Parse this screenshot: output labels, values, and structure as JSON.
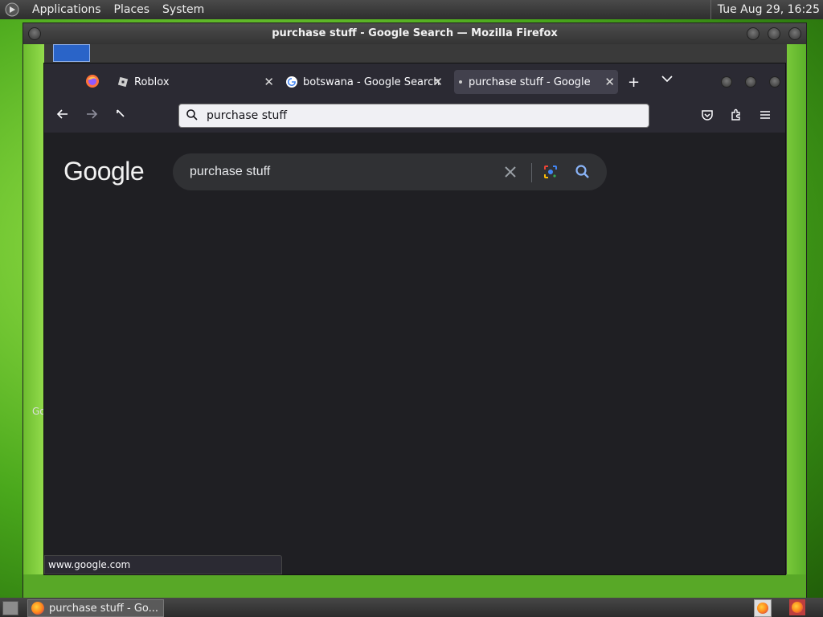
{
  "top_panel": {
    "menus": [
      "Applications",
      "Places",
      "System"
    ],
    "clock": "Tue Aug 29, 16:25"
  },
  "outer_window": {
    "title": "purchase stuff - Google Search — Mozilla Firefox",
    "left_strip_text": "Go"
  },
  "browser": {
    "tabs": [
      {
        "title": "Roblox",
        "icon": "roblox-icon",
        "active": false
      },
      {
        "title": "botswana - Google Search",
        "icon": "google-icon",
        "active": false
      },
      {
        "title": "purchase stuff - Google Se",
        "icon": "loading-dot",
        "active": true
      }
    ],
    "new_tab_glyph": "+",
    "tab_list_glyph": "⌄",
    "url": "purchase stuff",
    "status_text": "www.google.com"
  },
  "page": {
    "logo_text": "Google",
    "search_query": "purchase stuff"
  },
  "taskbar": {
    "task_label": "purchase stuff - Go..."
  },
  "colors": {
    "tab_bg": "#2b2a33",
    "active_tab": "#42414d",
    "content_bg": "#1f1f23",
    "search_box": "#303134",
    "accent_blue": "#8ab4f8"
  }
}
